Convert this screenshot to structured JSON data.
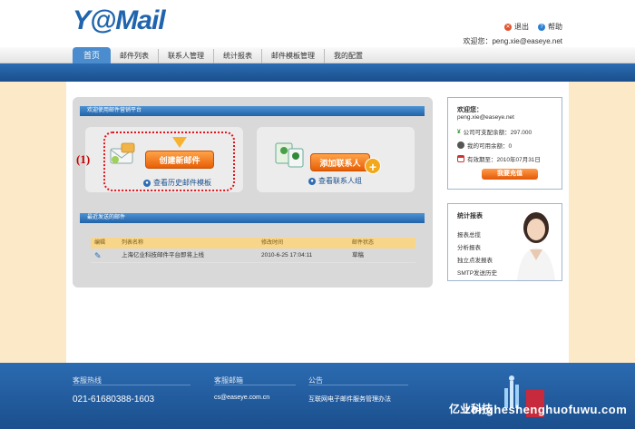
{
  "header": {
    "logo": "Y@Mail",
    "logout": "退出",
    "help": "帮助",
    "welcome": "欢迎您：peng.xie@easeye.net"
  },
  "nav": {
    "items": [
      "首页",
      "邮件列表",
      "联系人管理",
      "统计报表",
      "邮件模板管理",
      "我的配置"
    ]
  },
  "main": {
    "section_title": "欢迎使用邮件营销平台",
    "create_button": "创建新邮件",
    "history_link": "查看历史邮件模板",
    "add_contact_button": "添加联系人",
    "view_groups_link": "查看联系人组",
    "marker": "(1)",
    "recent_title": "最近发送的邮件",
    "table": {
      "headers": [
        "编辑",
        "列表名称",
        "修改时间",
        "邮件状态"
      ],
      "rows": [
        {
          "name": "上海亿业科技邮件平台即将上线",
          "time": "2010-6-25 17:04:11",
          "status": "草稿"
        }
      ]
    }
  },
  "sidebar": {
    "welcome": "欢迎您：",
    "email": "peng.xie@easeye.net",
    "balance": "公司可支配余额：297.000",
    "my_balance": "我的可用余额：0",
    "expire": "有效期至：2010年07月31日",
    "pay_button": "我要充值",
    "stats_title": "统计报表",
    "stats_items": [
      "报表总揽",
      "分析报表",
      "独立点发报表",
      "SMTP发送历史"
    ]
  },
  "footer": {
    "hotline_label": "客服热线",
    "hotline": "021-61680388-1603",
    "email_label": "客服邮箱",
    "email": "cs@easeye.com.cn",
    "notice_label": "公告",
    "notice": "互联网电子邮件服务管理办法",
    "brand": "亿业科技",
    "watermark": "zongheshenghuofuwu.com"
  },
  "colors": {
    "primary_blue": "#1f64ad",
    "orange": "#e85e05",
    "background": "#fbe9c8"
  }
}
